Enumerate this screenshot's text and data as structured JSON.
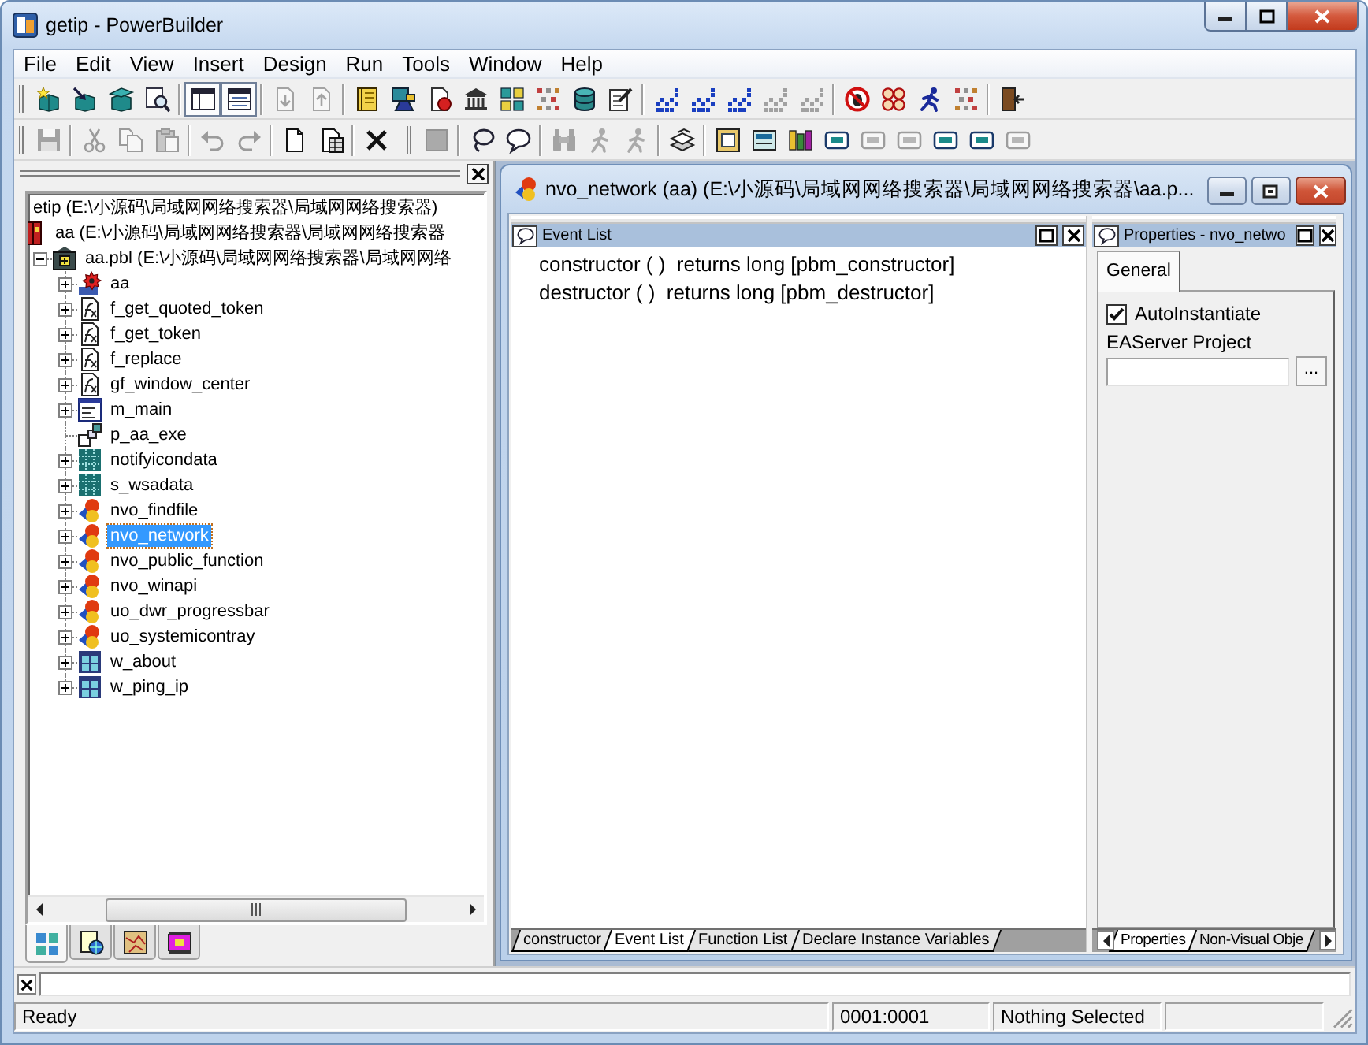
{
  "window": {
    "title": "getip - PowerBuilder"
  },
  "menu": [
    "File",
    "Edit",
    "View",
    "Insert",
    "Design",
    "Run",
    "Tools",
    "Window",
    "Help"
  ],
  "toolbar_rows": [
    [
      {
        "groups": [
          [
            {
              "disabled": false,
              "pressed": false
            },
            {
              "disabled": false,
              "pressed": false
            },
            {
              "disabled": false,
              "pressed": false
            },
            {
              "disabled": false,
              "pressed": false
            }
          ],
          [
            {
              "disabled": false,
              "pressed": true
            },
            {
              "disabled": false,
              "pressed": true
            }
          ],
          [
            {
              "disabled": true,
              "pressed": false
            },
            {
              "disabled": true,
              "pressed": false
            }
          ],
          [
            {
              "disabled": false,
              "pressed": false
            },
            {
              "disabled": false,
              "pressed": false
            },
            {
              "disabled": false,
              "pressed": false
            },
            {
              "disabled": false,
              "pressed": false
            },
            {
              "disabled": false,
              "pressed": false
            },
            {
              "disabled": false,
              "pressed": false
            },
            {
              "disabled": false,
              "pressed": false
            },
            {
              "disabled": false,
              "pressed": false
            }
          ],
          [
            {
              "disabled": false,
              "pressed": false
            },
            {
              "disabled": false,
              "pressed": false
            },
            {
              "disabled": false,
              "pressed": false
            },
            {
              "disabled": true,
              "pressed": false
            },
            {
              "disabled": true,
              "pressed": false
            }
          ],
          [
            {
              "disabled": false,
              "pressed": false
            },
            {
              "disabled": false,
              "pressed": false
            },
            {
              "disabled": false,
              "pressed": false
            },
            {
              "disabled": false,
              "pressed": false
            }
          ],
          [
            {
              "disabled": false,
              "pressed": false
            }
          ]
        ]
      }
    ],
    [
      {
        "groups": [
          [
            {
              "disabled": true,
              "pressed": false
            }
          ],
          [
            {
              "disabled": true,
              "pressed": false
            },
            {
              "disabled": true,
              "pressed": false
            },
            {
              "disabled": true,
              "pressed": false
            }
          ],
          [
            {
              "disabled": true,
              "pressed": false
            },
            {
              "disabled": true,
              "pressed": false
            }
          ],
          [
            {
              "disabled": false,
              "pressed": false
            },
            {
              "disabled": false,
              "pressed": false
            }
          ],
          [
            {
              "disabled": false,
              "pressed": false
            }
          ]
        ]
      },
      {
        "groups": [
          [
            {
              "disabled": true,
              "pressed": false
            }
          ],
          [
            {
              "disabled": false,
              "pressed": false
            },
            {
              "disabled": false,
              "pressed": false
            }
          ],
          [
            {
              "disabled": true,
              "pressed": false
            },
            {
              "disabled": true,
              "pressed": false
            },
            {
              "disabled": true,
              "pressed": false
            }
          ],
          [
            {
              "disabled": false,
              "pressed": false
            }
          ],
          [
            {
              "disabled": false,
              "pressed": false
            },
            {
              "disabled": false,
              "pressed": false
            },
            {
              "disabled": false,
              "pressed": false
            },
            {
              "disabled": false,
              "pressed": false
            },
            {
              "disabled": true,
              "pressed": false
            },
            {
              "disabled": true,
              "pressed": false
            },
            {
              "disabled": false,
              "pressed": false
            },
            {
              "disabled": false,
              "pressed": false
            },
            {
              "disabled": true,
              "pressed": false
            }
          ]
        ]
      }
    ]
  ],
  "library_panel": {
    "tree": [
      {
        "label": "etip (E:\\小源码\\局域网网络搜索器\\局域网网络搜索器)",
        "selected": false,
        "children": [
          {
            "label": "aa (E:\\小源码\\局域网网络搜索器\\局域网网络搜索器",
            "kind": "target",
            "selected": false,
            "children": [
              {
                "label": "aa.pbl (E:\\小源码\\局域网网络搜索器\\局域网网络",
                "kind": "library",
                "expandable": true,
                "expanded": true,
                "selected": false,
                "children": [
                  {
                    "label": "aa",
                    "kind": "application",
                    "expandable": true,
                    "expanded": false,
                    "selected": false
                  },
                  {
                    "label": "f_get_quoted_token",
                    "kind": "function",
                    "expandable": true,
                    "expanded": false,
                    "selected": false
                  },
                  {
                    "label": "f_get_token",
                    "kind": "function",
                    "expandable": true,
                    "expanded": false,
                    "selected": false
                  },
                  {
                    "label": "f_replace",
                    "kind": "function",
                    "expandable": true,
                    "expanded": false,
                    "selected": false
                  },
                  {
                    "label": "gf_window_center",
                    "kind": "function",
                    "expandable": true,
                    "expanded": false,
                    "selected": false
                  },
                  {
                    "label": "m_main",
                    "kind": "menu",
                    "expandable": true,
                    "expanded": false,
                    "selected": false
                  },
                  {
                    "label": "p_aa_exe",
                    "kind": "project",
                    "expandable": false,
                    "selected": false
                  },
                  {
                    "label": "notifyicondata",
                    "kind": "structure",
                    "expandable": true,
                    "expanded": false,
                    "selected": false
                  },
                  {
                    "label": "s_wsadata",
                    "kind": "structure",
                    "expandable": true,
                    "expanded": false,
                    "selected": false
                  },
                  {
                    "label": "nvo_findfile",
                    "kind": "object",
                    "expandable": true,
                    "expanded": false,
                    "selected": false
                  },
                  {
                    "label": "nvo_network",
                    "kind": "object",
                    "expandable": true,
                    "expanded": false,
                    "selected": true
                  },
                  {
                    "label": "nvo_public_function",
                    "kind": "object",
                    "expandable": true,
                    "expanded": false,
                    "selected": false
                  },
                  {
                    "label": "nvo_winapi",
                    "kind": "object",
                    "expandable": true,
                    "expanded": false,
                    "selected": false
                  },
                  {
                    "label": "uo_dwr_progressbar",
                    "kind": "object",
                    "expandable": true,
                    "expanded": false,
                    "selected": false
                  },
                  {
                    "label": "uo_systemicontray",
                    "kind": "object",
                    "expandable": true,
                    "expanded": false,
                    "selected": false
                  },
                  {
                    "label": "w_about",
                    "kind": "window",
                    "expandable": true,
                    "expanded": false,
                    "selected": false
                  },
                  {
                    "label": "w_ping_ip",
                    "kind": "window",
                    "expandable": true,
                    "expanded": false,
                    "selected": false
                  }
                ]
              }
            ]
          }
        ]
      }
    ],
    "tabs": [
      {
        "selected": true
      },
      {
        "selected": false
      },
      {
        "selected": false
      },
      {
        "selected": false
      }
    ]
  },
  "editor": {
    "title": "nvo_network (aa) (E:\\小源码\\局域网网络搜索器\\局域网网络搜索器\\aa.p...",
    "event_list": {
      "title": "Event List",
      "events": [
        "constructor ( )  returns long [pbm_constructor]",
        "destructor ( )  returns long [pbm_destructor]"
      ]
    },
    "tabs": [
      {
        "label": "constructor",
        "selected": false
      },
      {
        "label": "Event List",
        "selected": true
      },
      {
        "label": "Function List",
        "selected": false
      },
      {
        "label": "Declare Instance Variables",
        "selected": false
      }
    ],
    "properties": {
      "title": "Properties - nvo_netwo",
      "tabs": [
        {
          "label": "General",
          "selected": true
        }
      ],
      "auto_instantiate": {
        "label": "AutoInstantiate",
        "checked": true
      },
      "easerver_project": {
        "label": "EAServer Project",
        "button": "..."
      },
      "bottom_tabs": [
        {
          "label": "Properties",
          "selected": true
        },
        {
          "label": "Non-Visual Obje",
          "selected": false
        }
      ]
    }
  },
  "status_bar": [
    "Ready",
    "0001:0001",
    "Nothing Selected"
  ]
}
